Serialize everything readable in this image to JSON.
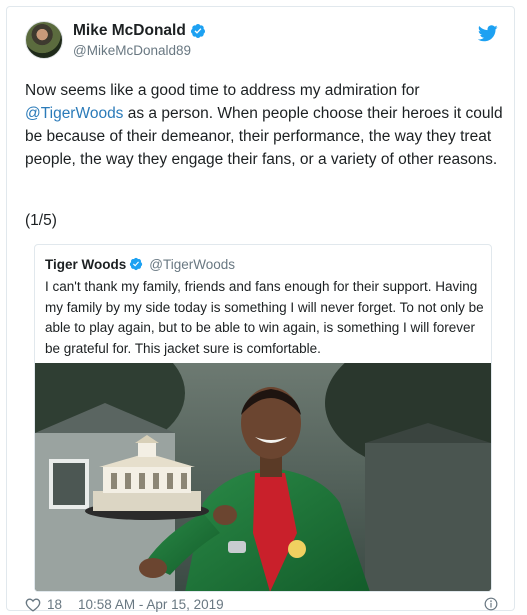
{
  "author": {
    "display_name": "Mike McDonald",
    "handle": "@MikeMcDonald89"
  },
  "tweet": {
    "text_before_mention": "Now seems like a good time to address my admiration for ",
    "mention": "@TigerWoods",
    "text_after_mention": " as a person. When people choose their heroes it could be because of their demeanor, their performance, the way they treat people, the way they engage their fans, or a variety of other reasons.",
    "thread_count": "(1/5)"
  },
  "quoted_tweet": {
    "display_name": "Tiger Woods",
    "handle": "@TigerWoods",
    "text": "I can't thank my family, friends and fans enough for their support. Having my family by my side today is something I will never forget. To not only be able to play again, but to be able to win again, is something I will forever be grateful for. This jacket sure is comfortable."
  },
  "footer": {
    "likes": "18",
    "timestamp": "10:58 AM - Apr 15, 2019"
  },
  "icons": {
    "verified": "verified-badge-icon",
    "twitter": "twitter-bird-icon",
    "like": "heart-icon",
    "info": "info-icon"
  },
  "colors": {
    "link": "#2b7bb9",
    "twitter_blue": "#1da1f2",
    "muted": "#697882",
    "jacket_green": "#1f7a3c"
  }
}
